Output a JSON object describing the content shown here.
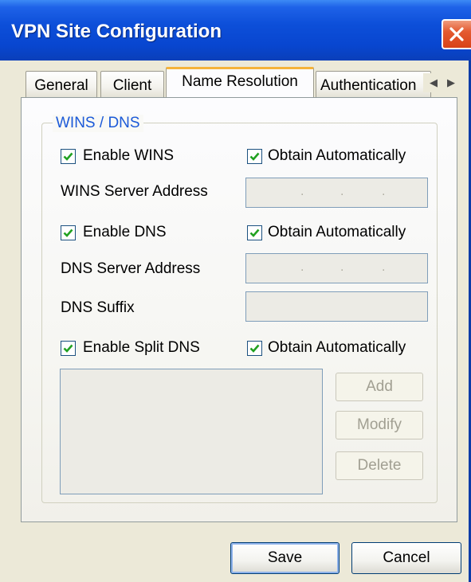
{
  "window": {
    "title": "VPN Site Configuration"
  },
  "tabs": [
    {
      "label": "General",
      "selected": false
    },
    {
      "label": "Client",
      "selected": false
    },
    {
      "label": "Name Resolution",
      "selected": true
    },
    {
      "label": "Authentication",
      "selected": false
    }
  ],
  "group": {
    "label": "WINS / DNS"
  },
  "wins": {
    "enable_label": "Enable WINS",
    "enable_checked": true,
    "auto_label": "Obtain Automatically",
    "auto_checked": true,
    "server_label": "WINS Server Address"
  },
  "dns": {
    "enable_label": "Enable DNS",
    "enable_checked": true,
    "auto_label": "Obtain Automatically",
    "auto_checked": true,
    "server_label": "DNS Server Address",
    "suffix_label": "DNS Suffix"
  },
  "split_dns": {
    "enable_label": "Enable Split DNS",
    "enable_checked": true,
    "auto_label": "Obtain Automatically",
    "auto_checked": true,
    "add_label": "Add",
    "modify_label": "Modify",
    "delete_label": "Delete"
  },
  "ip_separator": ".",
  "buttons": {
    "save": "Save",
    "cancel": "Cancel"
  },
  "colors": {
    "title_blue": "#0846d0",
    "accent_orange": "#f5b33a",
    "group_label": "#1c5ad8",
    "check_green": "#21a121"
  },
  "icons": {
    "close": "close-icon",
    "check": "checkmark-icon",
    "tab_left": "arrow-left-icon",
    "tab_right": "arrow-right-icon"
  }
}
